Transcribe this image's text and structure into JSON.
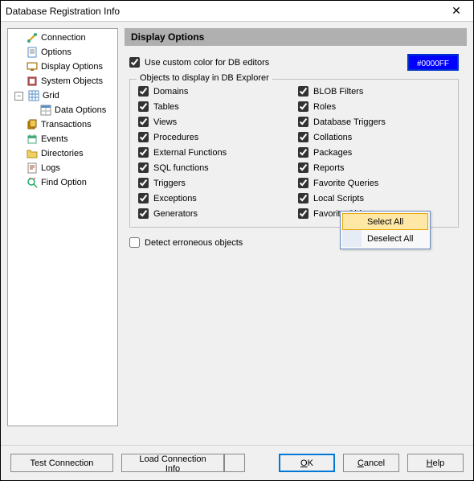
{
  "window": {
    "title": "Database Registration Info",
    "close": "✕"
  },
  "sidebar": {
    "items": [
      {
        "label": "Connection",
        "icon": "connection"
      },
      {
        "label": "Options",
        "icon": "options"
      },
      {
        "label": "Display Options",
        "icon": "display"
      },
      {
        "label": "System Objects",
        "icon": "system"
      },
      {
        "label": "Grid",
        "icon": "grid",
        "expanded": true
      },
      {
        "label": "Data Options",
        "icon": "data",
        "child": true
      },
      {
        "label": "Transactions",
        "icon": "transactions"
      },
      {
        "label": "Events",
        "icon": "events"
      },
      {
        "label": "Directories",
        "icon": "directories"
      },
      {
        "label": "Logs",
        "icon": "logs"
      },
      {
        "label": "Find Option",
        "icon": "find"
      }
    ]
  },
  "main": {
    "header": "Display Options",
    "custom_color_label": "Use custom color for DB editors",
    "custom_color_checked": true,
    "color_value": "#0000FF",
    "fieldset_legend": "Objects to display in DB Explorer",
    "col1": [
      {
        "label": "Domains",
        "checked": true
      },
      {
        "label": "Tables",
        "checked": true
      },
      {
        "label": "Views",
        "checked": true
      },
      {
        "label": "Procedures",
        "checked": true
      },
      {
        "label": "External Functions",
        "checked": true
      },
      {
        "label": "SQL functions",
        "checked": true
      },
      {
        "label": "Triggers",
        "checked": true
      },
      {
        "label": "Exceptions",
        "checked": true
      },
      {
        "label": "Generators",
        "checked": true
      }
    ],
    "col2": [
      {
        "label": "BLOB Filters",
        "checked": true
      },
      {
        "label": "Roles",
        "checked": true
      },
      {
        "label": "Database Triggers",
        "checked": true
      },
      {
        "label": "Collations",
        "checked": true
      },
      {
        "label": "Packages",
        "checked": true
      },
      {
        "label": "Reports",
        "checked": true
      },
      {
        "label": "Favorite Queries",
        "checked": true
      },
      {
        "label": "Local Scripts",
        "checked": true
      },
      {
        "label": "Favorite Objects",
        "checked": true
      }
    ],
    "detect_erroneous_label": "Detect erroneous objects",
    "detect_erroneous_checked": false
  },
  "context_menu": {
    "items": [
      {
        "label": "Select All",
        "highlighted": true
      },
      {
        "label": "Deselect All",
        "highlighted": false
      }
    ]
  },
  "buttons": {
    "test": "Test Connection",
    "load": "Load Connection Info",
    "ok": "OK",
    "cancel": "Cancel",
    "help": "Help"
  },
  "icons": {
    "connection": "🔗",
    "options": "📄",
    "display": "🖥",
    "system": "🗃",
    "grid": "▦",
    "data": "📊",
    "transactions": "📚",
    "events": "📆",
    "directories": "📁",
    "logs": "📜",
    "find": "🔍"
  }
}
